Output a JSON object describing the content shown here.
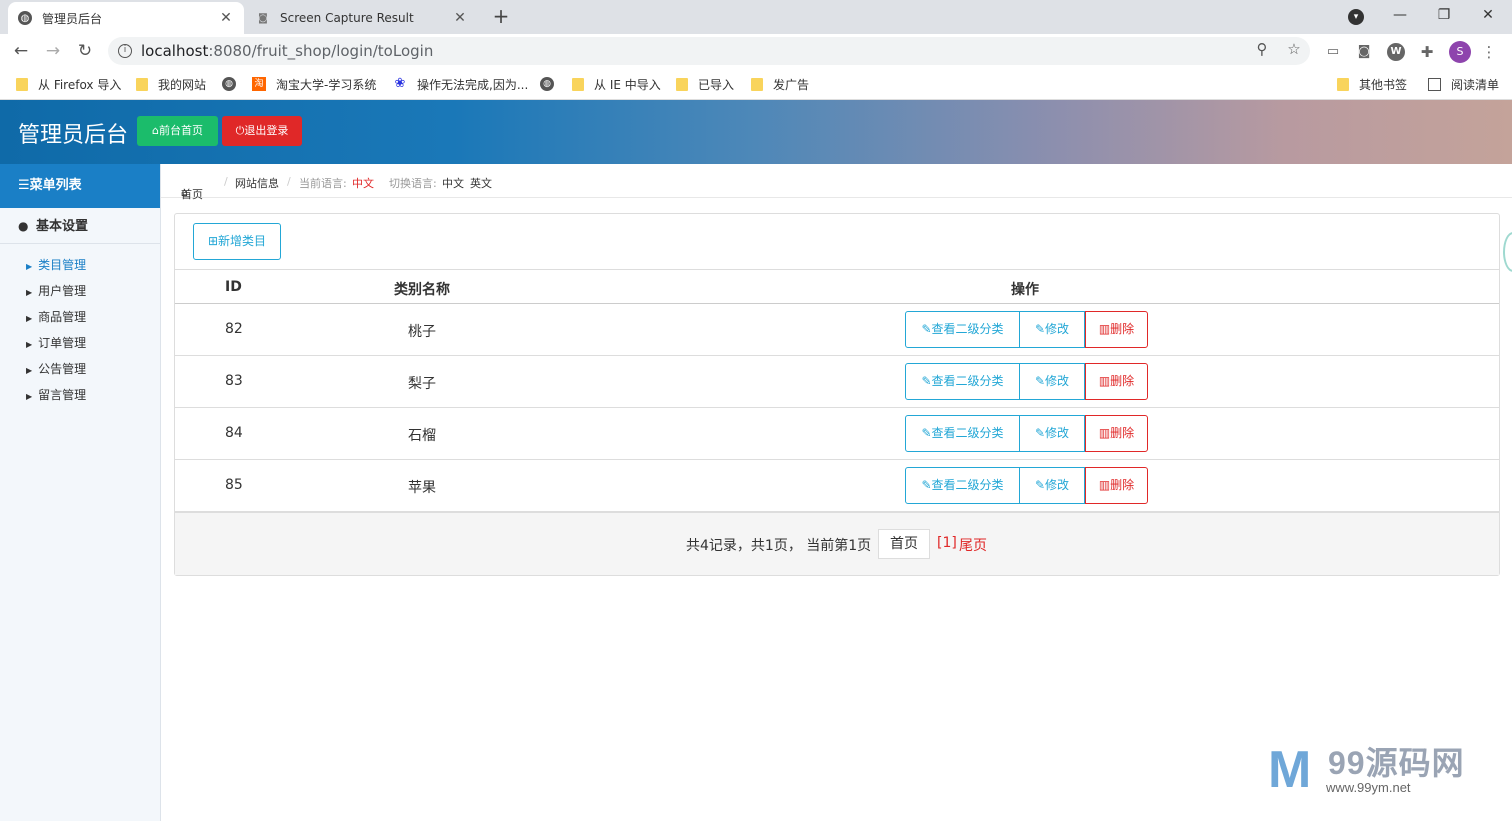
{
  "browser": {
    "tabs": [
      {
        "title": "管理员后台",
        "active": true
      },
      {
        "title": "Screen Capture Result",
        "active": false
      }
    ],
    "url_host": "localhost",
    "url_path": ":8080/fruit_shop/login/toLogin",
    "profile_initial": "S",
    "bookmarks": [
      {
        "label": "从 Firefox 导入",
        "icon": "folder-icon"
      },
      {
        "label": "我的网站",
        "icon": "folder-icon"
      },
      {
        "label": "",
        "icon": "globe-icon"
      },
      {
        "label": "淘宝大学-学习系统",
        "icon": "taobao-icon"
      },
      {
        "label": "操作无法完成,因为...",
        "icon": "baidu-paw-icon"
      },
      {
        "label": "",
        "icon": "globe-icon"
      },
      {
        "label": "从 IE 中导入",
        "icon": "folder-icon"
      },
      {
        "label": "已导入",
        "icon": "folder-icon"
      },
      {
        "label": "发广告",
        "icon": "folder-icon"
      }
    ],
    "other_bookmarks": "其他书签",
    "reading_list": "阅读清单"
  },
  "header": {
    "title": "管理员后台",
    "home_button": "前台首页",
    "logout_button": "退出登录",
    "colors": {
      "home": "#1bbc6b",
      "logout": "#e02828"
    }
  },
  "sidebar": {
    "menu_title": "菜单列表",
    "group_title": "基本设置",
    "items": [
      {
        "label": "类目管理",
        "active": true
      },
      {
        "label": "用户管理",
        "active": false
      },
      {
        "label": "商品管理",
        "active": false
      },
      {
        "label": "订单管理",
        "active": false
      },
      {
        "label": "公告管理",
        "active": false
      },
      {
        "label": "留言管理",
        "active": false
      }
    ]
  },
  "breadcrumb": {
    "home": "首页",
    "site_info": "网站信息",
    "current_lang_label": "当前语言:",
    "current_lang": "中文",
    "switch_lang_label": "切换语言:",
    "lang_zh": "中文",
    "lang_en": "英文"
  },
  "main": {
    "add_button": "新增类目",
    "columns": [
      "ID",
      "类别名称",
      "操作"
    ],
    "rows": [
      {
        "id": "82",
        "name": "桃子"
      },
      {
        "id": "83",
        "name": "梨子"
      },
      {
        "id": "84",
        "name": "石榴"
      },
      {
        "id": "85",
        "name": "苹果"
      }
    ],
    "actions": {
      "view": "查看二级分类",
      "edit": "修改",
      "delete": "删除"
    },
    "pager": {
      "info": "共4记录，共1页， 当前第1页",
      "first": "首页",
      "current": "[1]",
      "last": "尾页"
    }
  },
  "watermark": {
    "title": "99源码网",
    "subtitle": "www.99ym.net"
  }
}
